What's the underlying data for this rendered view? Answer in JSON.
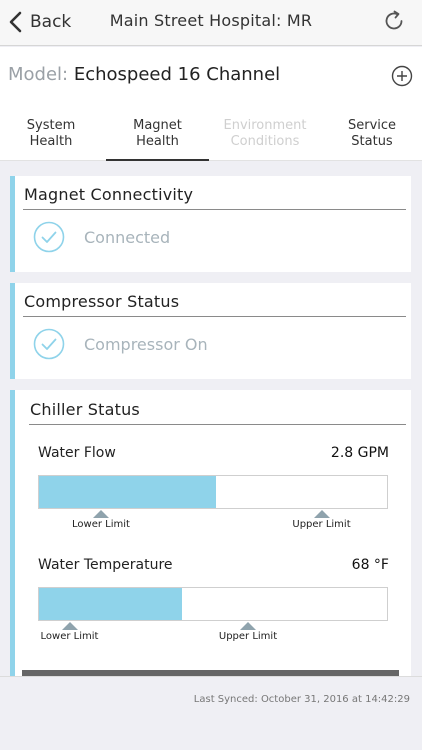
{
  "nav": {
    "back_label": "Back",
    "title": "Main Street Hospital: MR"
  },
  "model": {
    "label": "Model:",
    "value": "Echospeed 16 Channel"
  },
  "tabs": [
    {
      "label": "System Health",
      "active": false,
      "disabled": false
    },
    {
      "label": "Magnet Health",
      "active": true,
      "disabled": false
    },
    {
      "label": "Environment Conditions",
      "active": false,
      "disabled": true
    },
    {
      "label": "Service Status",
      "active": false,
      "disabled": false
    }
  ],
  "magnet_connectivity": {
    "title": "Magnet Connectivity",
    "status": "Connected"
  },
  "compressor_status": {
    "title": "Compressor Status",
    "status": "Compressor On"
  },
  "chiller_status": {
    "title": "Chiller Status",
    "water_flow": {
      "label": "Water Flow",
      "value": "2.8 GPM",
      "fill_fraction": 0.51,
      "lower_limit_label": "Lower Limit",
      "upper_limit_label": "Upper Limit",
      "lower_limit_fraction": 0.18,
      "upper_limit_fraction": 0.81
    },
    "water_temperature": {
      "label": "Water Temperature",
      "value": "68 °F",
      "fill_fraction": 0.41,
      "lower_limit_label": "Lower Limit",
      "upper_limit_label": "Upper Limit",
      "lower_limit_fraction": 0.09,
      "upper_limit_fraction": 0.6
    }
  },
  "footer": {
    "last_synced": "Last Synced: October 31, 2016 at 14:42:29"
  },
  "colors": {
    "accent": "#8fd3ea",
    "check": "#8fd3ea",
    "status_text": "#a8b4bb",
    "marker": "#8fa3ad"
  }
}
